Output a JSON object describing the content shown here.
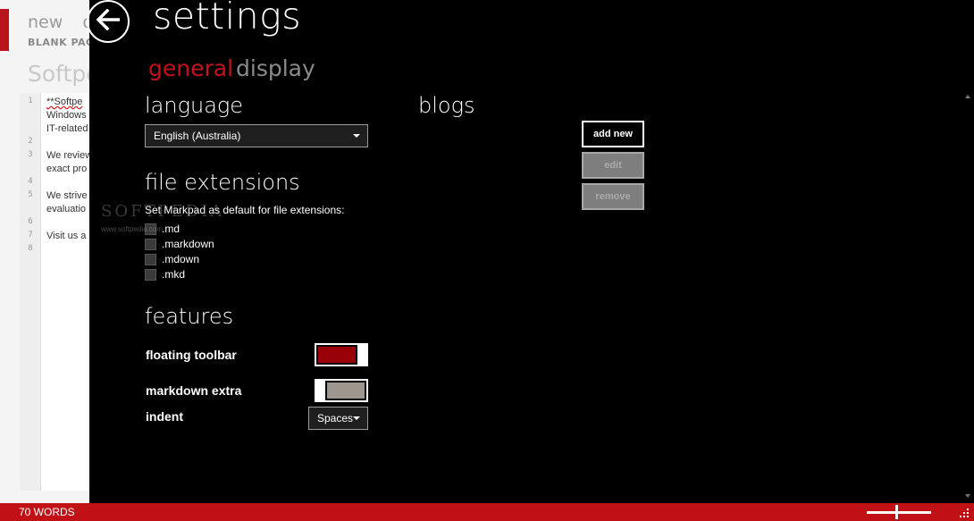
{
  "background": {
    "tabs": [
      "new",
      "o"
    ],
    "subtitle": "BLANK PAG",
    "doc_title": "Softpe",
    "line_numbers": [
      "1",
      "2",
      "3",
      "4",
      "5",
      "6",
      "7",
      "8"
    ],
    "lines": [
      "**Softpe",
      "Windows",
      "IT-related",
      "We review",
      "exact pro",
      "We strive",
      "evaluatio",
      "Visit us a"
    ]
  },
  "settings": {
    "title": "settings",
    "back_icon": "back-arrow-icon",
    "tabs": {
      "general": "general",
      "display": "display"
    },
    "language": {
      "heading": "language",
      "selected": "English (Australia)"
    },
    "file_extensions": {
      "heading": "file extensions",
      "caption": "Set Markpad as default for file extensions:",
      "items": [
        ".md",
        ".markdown",
        ".mdown",
        ".mkd"
      ]
    },
    "features": {
      "heading": "features",
      "floating_toolbar": {
        "label": "floating toolbar",
        "state": "on"
      },
      "markdown_extra": {
        "label": "markdown extra",
        "state": "off"
      },
      "indent": {
        "label": "indent",
        "selected": "Spaces"
      }
    },
    "blogs": {
      "heading": "blogs",
      "add_new": "add new",
      "edit": "edit",
      "remove": "remove"
    }
  },
  "watermark": {
    "text": "SOFTPEDIA",
    "url": "www.softpedia.com"
  },
  "status_bar": {
    "words": "70 WORDS"
  },
  "colors": {
    "accent": "#c4111d",
    "status_bar": "#c11016",
    "toggle_on": "#9a0008",
    "toggle_off": "#9e978f",
    "disabled_button": "#7e7e7e"
  }
}
